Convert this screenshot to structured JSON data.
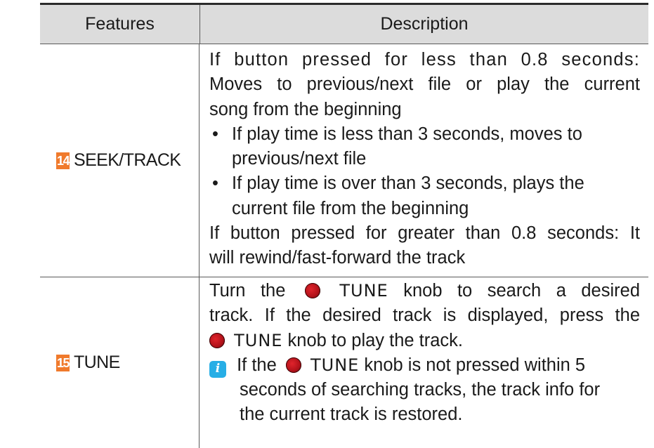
{
  "table": {
    "headers": {
      "features": "Features",
      "description": "Description"
    },
    "rows": [
      {
        "number": "14",
        "feature": "SEEK/TRACK",
        "lines": [
          "If button pressed for less than 0.8 seconds:",
          "Moves to previous/next file or play the current",
          "song from the beginning"
        ],
        "bullets": [
          "If play time is less than 3 seconds, moves to previous/next file",
          "If play time is over than 3 seconds, plays the current file from the beginning"
        ],
        "tail_lines": [
          "If button pressed for greater than 0.8 seconds: It",
          "will rewind/fast-forward the track"
        ]
      },
      {
        "number": "15",
        "feature": "TUNE",
        "p1_a": "Turn the",
        "p1_tune": "TUNE",
        "p1_b": "knob to search a desired",
        "p1_line2": "track. If the desired track is displayed, press the",
        "p1_tune2": "TUNE",
        "p1_c": "knob to play the track.",
        "note_a": "If the",
        "note_tune": "TUNE",
        "note_b": "knob is not pressed within 5",
        "note_line2": "seconds of searching tracks, the track info for",
        "note_line3": "the current track is restored."
      }
    ]
  },
  "icons": {
    "knob_color": "#d41a22",
    "number_badge_color": "#f07a2c",
    "info_icon_color": "#27aee6"
  }
}
